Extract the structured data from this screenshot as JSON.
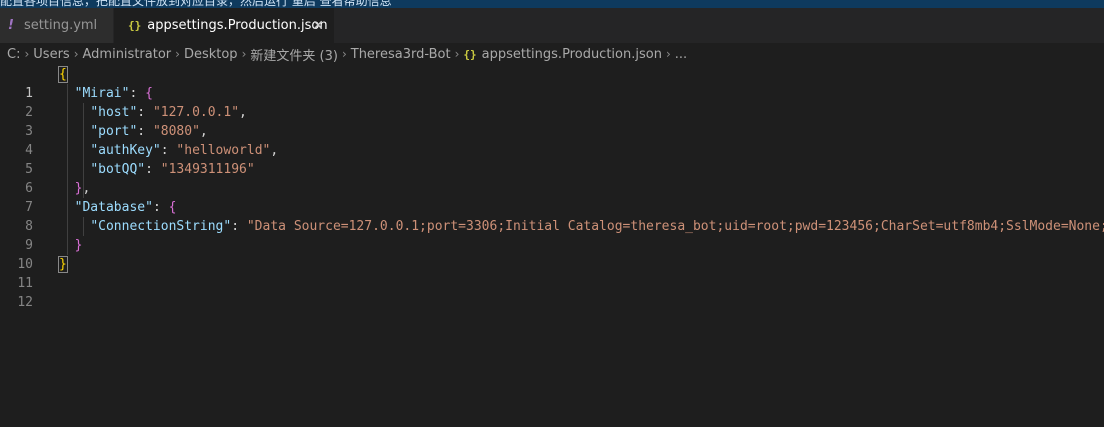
{
  "top_strip": {
    "text": "配置各项目信息，把配置文件放到对应目录，然后运行  重启  查看帮助信息"
  },
  "tabs": [
    {
      "icon": "!",
      "label": "setting.yml"
    },
    {
      "icon": "{}",
      "label": "appsettings.Production.json",
      "close": "✕"
    }
  ],
  "breadcrumb": [
    "C:",
    "Users",
    "Administrator",
    "Desktop",
    "新建文件夹 (3)",
    "Theresa3rd-Bot",
    "appsettings.Production.json",
    "..."
  ],
  "breadcrumb_file_icon": "{}",
  "editor": {
    "line_numbers": [
      "1",
      "2",
      "3",
      "4",
      "5",
      "6",
      "7",
      "8",
      "9",
      "10",
      "11",
      "12"
    ],
    "code": {
      "mirai_key": "\"Mirai\"",
      "host_key": "\"host\"",
      "host_val": "\"127.0.0.1\"",
      "port_key": "\"port\"",
      "port_val": "\"8080\"",
      "authkey_key": "\"authKey\"",
      "authkey_val": "\"helloworld\"",
      "botqq_key": "\"botQQ\"",
      "botqq_val": "\"1349311196\"",
      "database_key": "\"Database\"",
      "connstr_key": "\"ConnectionString\"",
      "connstr_val": "\"Data Source=127.0.0.1;port=3306;Initial Catalog=theresa_bot;uid=root;pwd=123456;CharSet=utf8mb4;SslMode=None;\""
    }
  },
  "colors": {
    "key": "#9cdcfe",
    "string": "#ce9178",
    "brace_outer": "#ffd700",
    "brace_inner": "#da70d6",
    "background": "#1e1e1e"
  }
}
